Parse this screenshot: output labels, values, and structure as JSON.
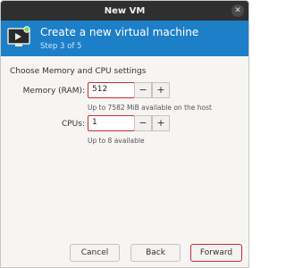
{
  "window": {
    "title": "New VM"
  },
  "header": {
    "title": "Create a new virtual machine",
    "step": "Step 3 of 5"
  },
  "section_label": "Choose Memory and CPU settings",
  "memory": {
    "label": "Memory (RAM):",
    "value": "512",
    "hint": "Up to 7582 MiB available on the host"
  },
  "cpus": {
    "label": "CPUs:",
    "value": "1",
    "hint": "Up to 8 available"
  },
  "stepper": {
    "minus": "−",
    "plus": "+"
  },
  "buttons": {
    "cancel": "Cancel",
    "back": "Back",
    "forward": "Forward"
  },
  "icons": {
    "close": "close-icon",
    "header": "monitor-icon"
  }
}
